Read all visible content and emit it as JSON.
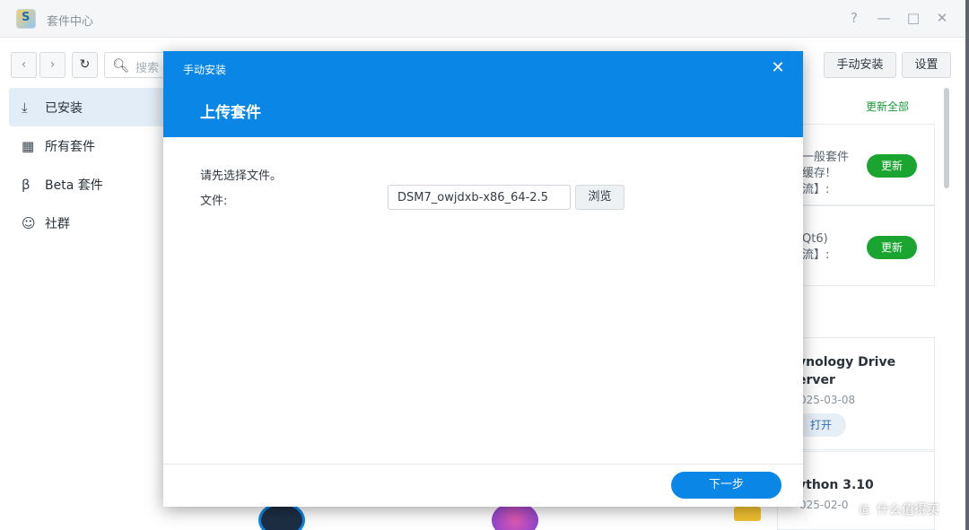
{
  "window": {
    "title": "套件中心",
    "controls": {
      "help": "?",
      "minimize": "—",
      "maximize": "□",
      "close": "✕"
    }
  },
  "toolbar": {
    "back_icon": "chevron-left-icon",
    "forward_icon": "chevron-right-icon",
    "refresh_icon": "refresh-icon",
    "search_placeholder": "搜索",
    "manual_install_label": "手动安装",
    "settings_label": "设置"
  },
  "sidebar": {
    "items": [
      {
        "label": "已安装",
        "icon": "download-icon",
        "active": true
      },
      {
        "label": "所有套件",
        "icon": "grid-icon",
        "active": false
      },
      {
        "label": "Beta 套件",
        "icon": "beta-icon",
        "active": false
      },
      {
        "label": "社群",
        "icon": "community-icon",
        "active": false
      }
    ]
  },
  "main": {
    "update_all_label": "更新全部",
    "update_cards": [
      {
        "text_lines": [
          "一般套件",
          "缓存!",
          "流】:"
        ],
        "button_label": "更新"
      },
      {
        "text_lines": [
          "Qt6)",
          "流】:"
        ],
        "button_label": "更新"
      }
    ],
    "installed_cards": [
      {
        "name_lines": [
          "ynology Drive",
          "erver"
        ],
        "date": "025-03-08",
        "button_label": "打开"
      },
      {
        "name_lines": [
          "ython 3.10"
        ],
        "date": "025-02-0"
      }
    ]
  },
  "dialog": {
    "window_title": "手动安装",
    "heading": "上传套件",
    "instruction": "请先选择文件。",
    "file_label": "文件:",
    "file_value": "DSM7_owjdxb-x86_64-2.5",
    "browse_label": "浏览",
    "next_label": "下一步",
    "accent_color": "#0a86e6"
  },
  "watermark": {
    "text": "什么值得买",
    "icon": "zhi"
  }
}
